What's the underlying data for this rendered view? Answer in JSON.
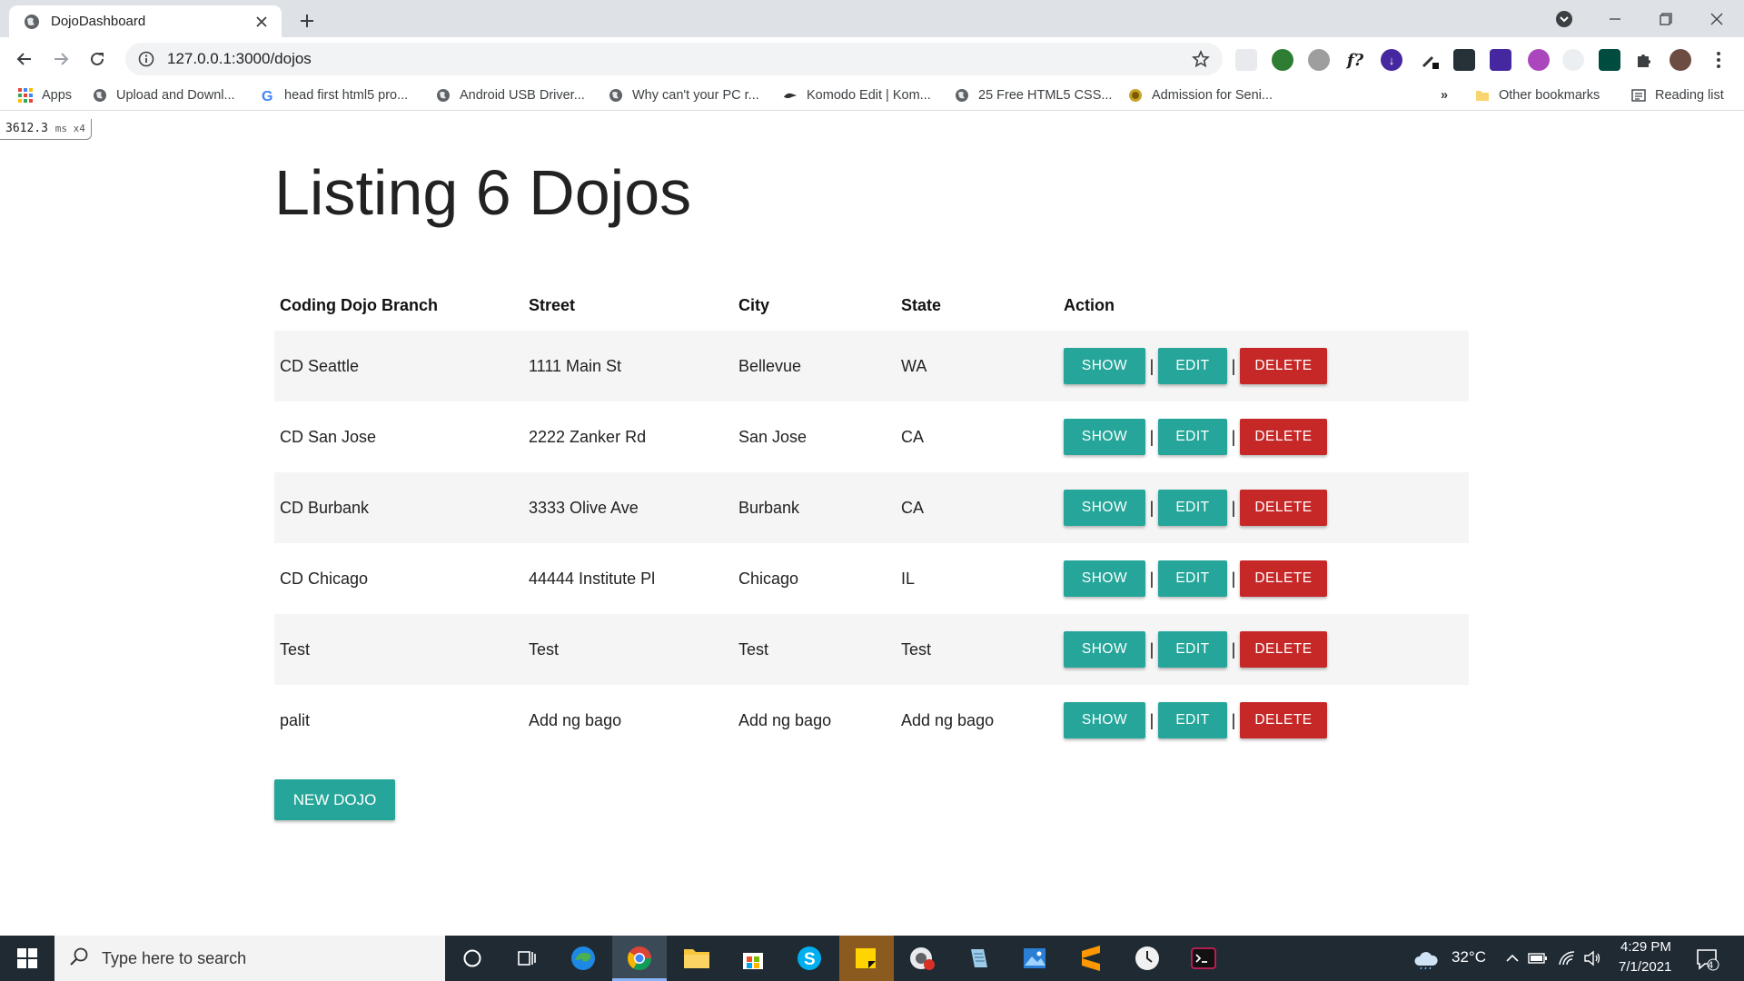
{
  "browser": {
    "tab_title": "DojoDashboard",
    "url": "127.0.0.1:3000/dojos"
  },
  "bookmarks": [
    {
      "label": "Apps",
      "icon": "apps-grid-icon"
    },
    {
      "label": "Upload and Downl...",
      "icon": "globe-icon"
    },
    {
      "label": "head first html5 pro...",
      "icon": "google-icon"
    },
    {
      "label": "Android USB Driver...",
      "icon": "globe-icon"
    },
    {
      "label": "Why can't your PC r...",
      "icon": "globe-icon"
    },
    {
      "label": "Komodo Edit | Kom...",
      "icon": "komodo-icon"
    },
    {
      "label": "25 Free HTML5 CSS...",
      "icon": "globe-icon"
    },
    {
      "label": "Admission for Seni...",
      "icon": "school-icon"
    }
  ],
  "bookmarks_right": {
    "other": "Other bookmarks",
    "reading": "Reading list",
    "overflow": "»"
  },
  "timer": {
    "ms": "3612.3",
    "unit": "ms x4"
  },
  "page": {
    "title": "Listing 6 Dojos",
    "headers": [
      "Coding Dojo Branch",
      "Street",
      "City",
      "State",
      "Action"
    ],
    "rows": [
      {
        "branch": "CD Seattle",
        "street": "1111 Main St",
        "city": "Bellevue",
        "state": "WA"
      },
      {
        "branch": "CD San Jose",
        "street": "2222 Zanker Rd",
        "city": "San Jose",
        "state": "CA"
      },
      {
        "branch": "CD Burbank",
        "street": "3333 Olive Ave",
        "city": "Burbank",
        "state": "CA"
      },
      {
        "branch": "CD Chicago",
        "street": "44444 Institute Pl",
        "city": "Chicago",
        "state": "IL"
      },
      {
        "branch": "Test",
        "street": "Test",
        "city": "Test",
        "state": "Test"
      },
      {
        "branch": "palit",
        "street": "Add ng bago",
        "city": "Add ng bago",
        "state": "Add ng bago"
      }
    ],
    "actions": {
      "show": "SHOW",
      "edit": "EDIT",
      "delete": "DELETE",
      "sep": "|"
    },
    "new_button": "NEW DOJO"
  },
  "colors": {
    "teal": "#26a69a",
    "red": "#c62828"
  },
  "taskbar": {
    "search_placeholder": "Type here to search",
    "temperature": "32°C",
    "time": "4:29 PM",
    "date": "7/1/2021",
    "notifications": "4"
  }
}
